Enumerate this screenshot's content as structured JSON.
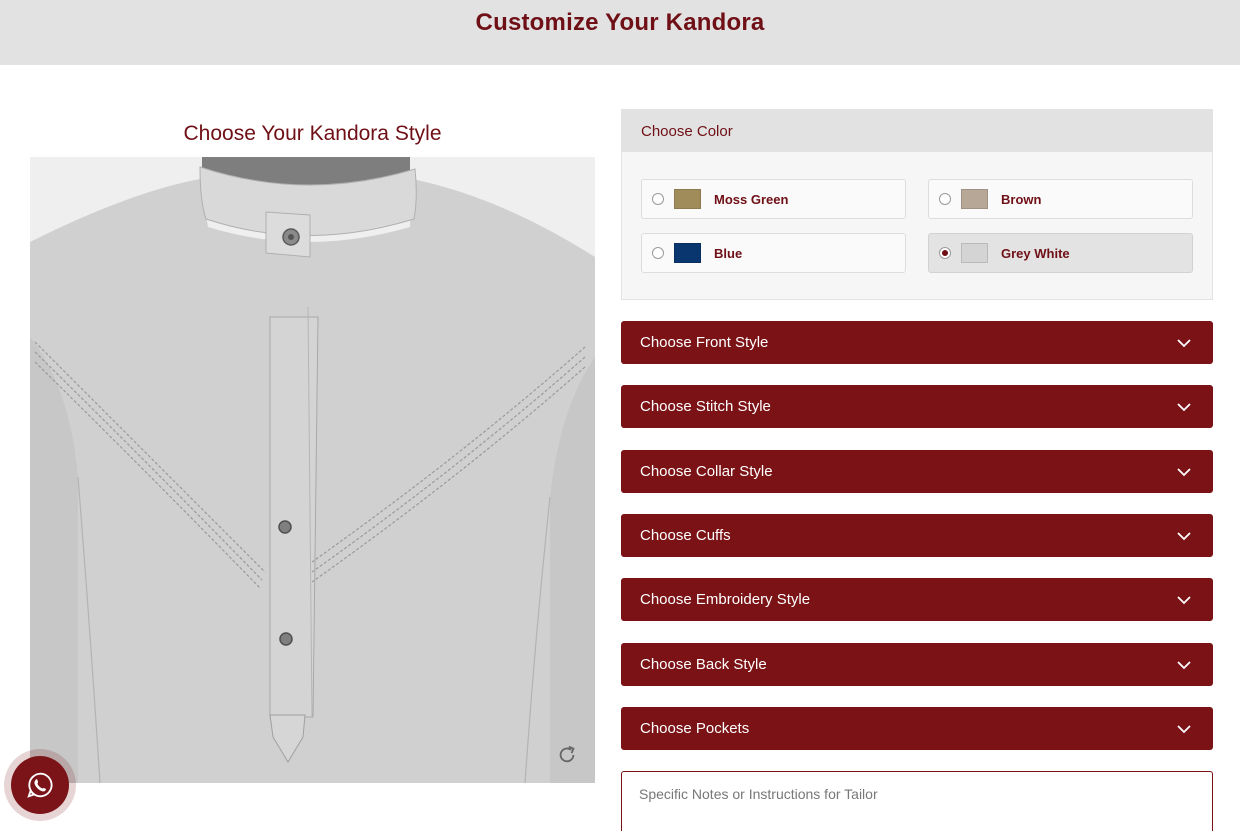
{
  "header": {
    "title": "Customize Your Kandora"
  },
  "preview": {
    "title": "Choose Your Kandora Style",
    "rotate_icon": "rotate-icon"
  },
  "color": {
    "heading": "Choose Color",
    "options": [
      {
        "label": "Moss Green",
        "swatch": "#a08c5a",
        "selected": false
      },
      {
        "label": "Brown",
        "swatch": "#b6a797",
        "selected": false
      },
      {
        "label": "Blue",
        "swatch": "#0a3670",
        "selected": false
      },
      {
        "label": "Grey White",
        "swatch": "#d4d4d4",
        "selected": true
      }
    ]
  },
  "sections": [
    {
      "label": "Choose Front Style"
    },
    {
      "label": "Choose Stitch Style"
    },
    {
      "label": "Choose Collar Style"
    },
    {
      "label": "Choose Cuffs"
    },
    {
      "label": "Choose Embroidery Style"
    },
    {
      "label": "Choose Back Style"
    },
    {
      "label": "Choose Pockets"
    }
  ],
  "notes": {
    "placeholder": "Specific Notes or Instructions for Tailor",
    "value": ""
  },
  "whatsapp": {
    "icon": "whatsapp-icon"
  },
  "colors": {
    "accent": "#7a1216",
    "title": "#6f0f16",
    "header_bg": "#e2e2e2"
  }
}
